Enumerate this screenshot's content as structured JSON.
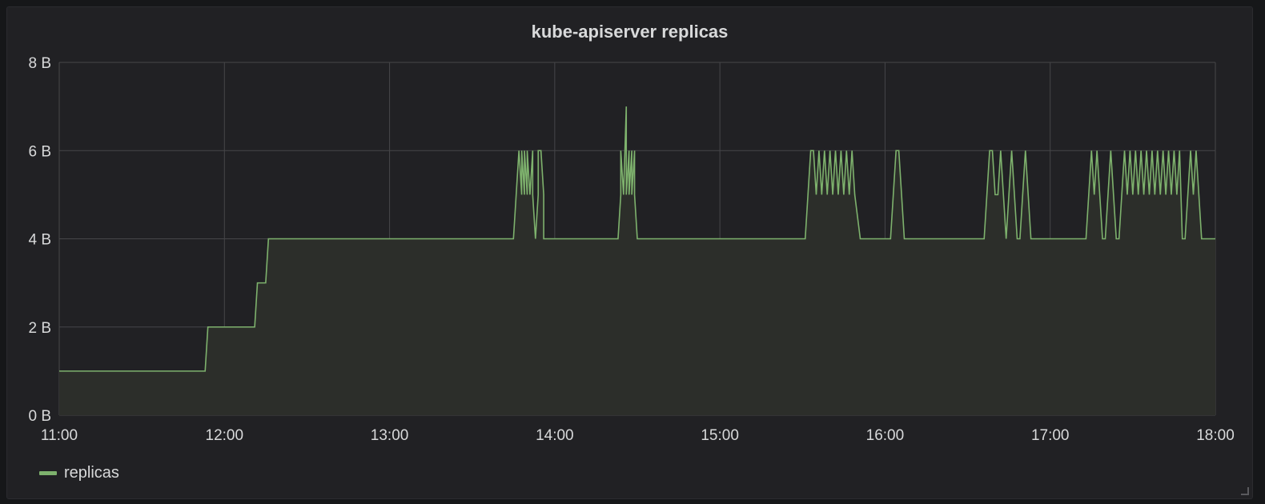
{
  "panel": {
    "title": "kube-apiserver replicas"
  },
  "colors": {
    "series": "#7eb26d",
    "fill": "#2c2e2a",
    "grid": "#464649",
    "axis_text": "#d8d9da",
    "panel_bg": "#212124",
    "title": "#d8d9da"
  },
  "legend": {
    "placement": "bottom-left",
    "items": [
      {
        "label": "replicas",
        "color": "#7eb26d"
      }
    ]
  },
  "chart_data": {
    "type": "area",
    "title": "kube-apiserver replicas",
    "xlabel": "",
    "ylabel": "",
    "grid": true,
    "x_ticks": [
      "11:00",
      "12:00",
      "13:00",
      "14:00",
      "15:00",
      "16:00",
      "17:00",
      "18:00"
    ],
    "y_ticks": [
      "0 B",
      "2 B",
      "4 B",
      "6 B",
      "8 B"
    ],
    "xlim": [
      "11:00",
      "18:00"
    ],
    "ylim": [
      0,
      8
    ],
    "series": [
      {
        "name": "replicas",
        "color": "#7eb26d",
        "x": [
          "11:00",
          "11:53",
          "11:54",
          "12:11",
          "12:12",
          "12:15",
          "12:16",
          "12:19",
          "13:45",
          "13:46",
          "13:47",
          "13:48",
          "13:48",
          "13:49",
          "13:49",
          "13:50",
          "13:50",
          "13:51",
          "13:52",
          "13:52",
          "13:53",
          "13:54",
          "13:54",
          "13:55",
          "13:56",
          "13:56",
          "13:57",
          "13:57",
          "13:58",
          "13:58",
          "14:23",
          "14:24",
          "14:24",
          "14:25",
          "14:26",
          "14:26",
          "14:27",
          "14:27",
          "14:28",
          "14:28",
          "14:29",
          "14:29",
          "14:30",
          "14:31",
          "15:31",
          "15:32",
          "15:33",
          "15:34",
          "15:35",
          "15:36",
          "15:37",
          "15:38",
          "15:39",
          "15:40",
          "15:41",
          "15:42",
          "15:43",
          "15:44",
          "15:45",
          "15:46",
          "15:47",
          "15:48",
          "15:49",
          "15:51",
          "16:02",
          "16:03",
          "16:04",
          "16:05",
          "16:06",
          "16:07",
          "16:36",
          "16:37",
          "16:38",
          "16:39",
          "16:40",
          "16:41",
          "16:42",
          "16:43",
          "16:44",
          "16:45",
          "16:46",
          "16:47",
          "16:48",
          "16:49",
          "16:50",
          "16:51",
          "16:52",
          "16:53",
          "17:13",
          "17:14",
          "17:15",
          "17:16",
          "17:17",
          "17:18",
          "17:19",
          "17:20",
          "17:21",
          "17:22",
          "17:23",
          "17:24",
          "17:25",
          "17:26",
          "17:27",
          "17:28",
          "17:29",
          "17:30",
          "17:31",
          "17:32",
          "17:33",
          "17:34",
          "17:35",
          "17:36",
          "17:37",
          "17:38",
          "17:39",
          "17:40",
          "17:41",
          "17:42",
          "17:43",
          "17:44",
          "17:45",
          "17:46",
          "17:47",
          "17:48",
          "17:49",
          "17:50",
          "17:51",
          "17:52",
          "17:53",
          "17:54",
          "17:55",
          "17:56",
          "17:57",
          "17:58",
          "17:59",
          "18:00"
        ],
        "values": [
          1,
          1,
          2,
          2,
          3,
          3,
          4,
          4,
          4,
          5,
          6,
          5,
          6,
          5,
          6,
          5,
          6,
          5,
          6,
          5,
          4,
          5,
          6,
          6,
          5,
          4,
          4,
          4,
          4,
          4,
          4,
          5,
          6,
          5,
          7,
          5,
          6,
          5,
          6,
          5,
          6,
          5,
          4,
          4,
          4,
          5,
          6,
          6,
          5,
          6,
          5,
          6,
          5,
          6,
          5,
          6,
          5,
          6,
          5,
          6,
          5,
          6,
          5,
          4,
          4,
          5,
          6,
          6,
          5,
          4,
          4,
          5,
          6,
          6,
          5,
          5,
          6,
          5,
          4,
          5,
          6,
          5,
          4,
          4,
          5,
          6,
          5,
          4,
          4,
          5,
          6,
          5,
          6,
          5,
          4,
          4,
          5,
          6,
          5,
          4,
          4,
          5,
          6,
          5,
          6,
          5,
          6,
          5,
          6,
          5,
          6,
          5,
          6,
          5,
          6,
          5,
          6,
          5,
          6,
          5,
          6,
          5,
          6,
          4,
          4,
          5,
          6,
          5,
          6,
          5,
          4,
          4,
          4,
          4,
          4,
          4
        ]
      }
    ]
  }
}
